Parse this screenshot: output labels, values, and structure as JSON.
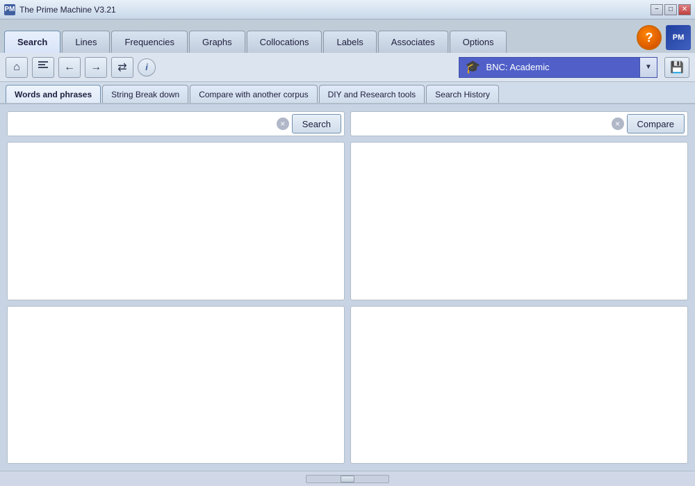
{
  "window": {
    "title": "The Prime Machine V3.21",
    "icon": "PM"
  },
  "title_buttons": {
    "minimize": "−",
    "maximize": "□",
    "close": "✕"
  },
  "tabs": [
    {
      "id": "search",
      "label": "Search",
      "active": true
    },
    {
      "id": "lines",
      "label": "Lines",
      "active": false
    },
    {
      "id": "frequencies",
      "label": "Frequencies",
      "active": false
    },
    {
      "id": "graphs",
      "label": "Graphs",
      "active": false
    },
    {
      "id": "collocations",
      "label": "Collocations",
      "active": false
    },
    {
      "id": "labels",
      "label": "Labels",
      "active": false
    },
    {
      "id": "associates",
      "label": "Associates",
      "active": false
    },
    {
      "id": "options",
      "label": "Options",
      "active": false
    }
  ],
  "toolbar": {
    "home_icon": "🏠",
    "list_icon": "≡",
    "back_icon": "←",
    "forward_icon": "→",
    "sync_icon": "⇄",
    "info_icon": "i",
    "corpus_name": "BNC: Academic",
    "corpus_cap": "🎓",
    "save_icon": "💾"
  },
  "sub_tabs": [
    {
      "id": "words_phrases",
      "label": "Words and phrases",
      "active": true
    },
    {
      "id": "string_breakdown",
      "label": "String Break down",
      "active": false
    },
    {
      "id": "compare_corpus",
      "label": "Compare with another corpus",
      "active": false
    },
    {
      "id": "diy_research",
      "label": "DIY and Research tools",
      "active": false
    },
    {
      "id": "search_history",
      "label": "Search History",
      "active": false
    }
  ],
  "left_panel": {
    "search_placeholder": "",
    "search_button": "Search",
    "clear_button": "×"
  },
  "right_panel": {
    "search_placeholder": "",
    "compare_button": "Compare",
    "clear_button": "×"
  }
}
